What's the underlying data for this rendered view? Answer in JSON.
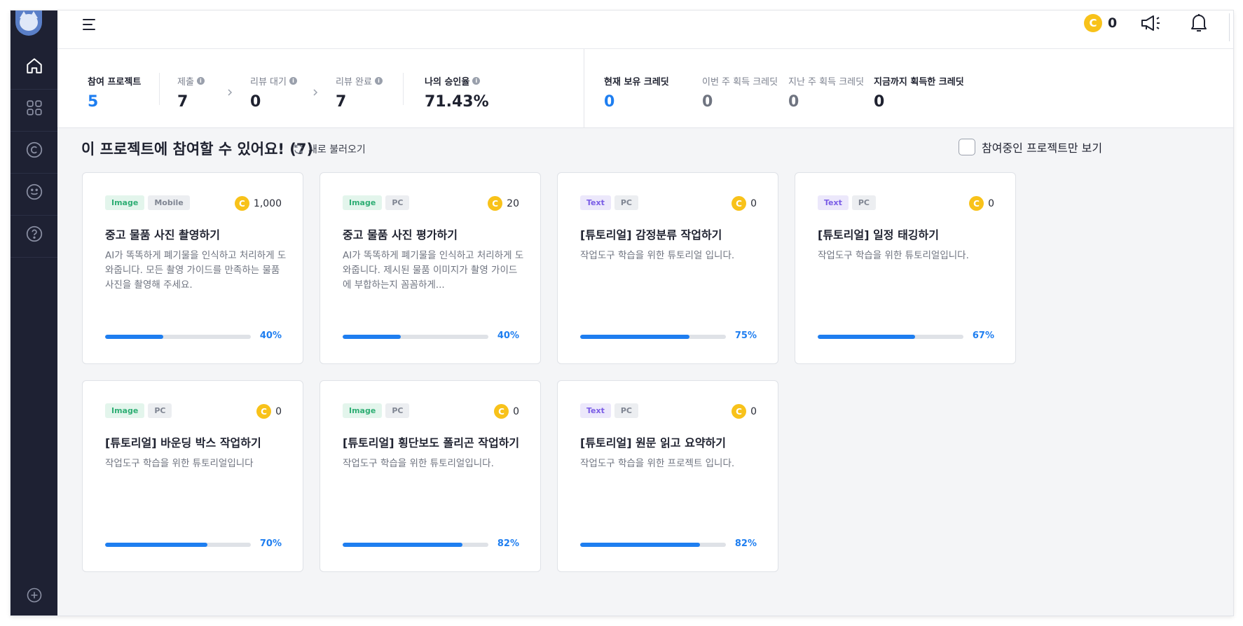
{
  "header": {
    "credit_value": "0",
    "coin_glyph": "C"
  },
  "sidebar": {
    "items": [
      {
        "name": "home",
        "icon": "home-icon"
      },
      {
        "name": "projects",
        "icon": "grid-icon"
      },
      {
        "name": "credit",
        "icon": "copyright-icon"
      },
      {
        "name": "profile",
        "icon": "smile-icon"
      },
      {
        "name": "help",
        "icon": "question-icon"
      }
    ],
    "add_icon": "plus-circle-icon"
  },
  "stats": {
    "participating_label": "참여 프로젝트",
    "participating_value": "5",
    "submitted_label": "제출",
    "submitted_value": "7",
    "review_pending_label": "리뷰 대기",
    "review_pending_value": "0",
    "review_done_label": "리뷰 완료",
    "review_done_value": "7",
    "approval_label": "나의 승인율",
    "approval_value": "71.43%",
    "credit_current_label": "현재 보유 크레딧",
    "credit_current_value": "0",
    "credit_this_week_label": "이번 주 획득 크레딧",
    "credit_this_week_value": "0",
    "credit_last_week_label": "지난 주 획득 크레딧",
    "credit_last_week_value": "0",
    "credit_total_label": "지금까지 획득한 크레딧",
    "credit_total_value": "0"
  },
  "section": {
    "title": "이 프로젝트에 참여할 수 있어요! (7)",
    "reload_label": "새로 불러오기",
    "filter_label": "참여중인 프로젝트만 보기"
  },
  "projects": [
    {
      "type": "Image",
      "platform": "Mobile",
      "reward": "1,000",
      "title": "중고 물품 사진 촬영하기",
      "desc": "AI가 똑똑하게 폐기물을 인식하고 처리하게 도와줍니다. 모든 촬영 가이드를 만족하는 물품 사진을 촬영해 주세요.",
      "progress_pct": 40,
      "progress_label": "40%"
    },
    {
      "type": "Image",
      "platform": "PC",
      "reward": "20",
      "title": "중고 물품 사진 평가하기",
      "desc": "AI가 똑똑하게 폐기물을 인식하고 처리하게 도와줍니다. 제시된 물품 이미지가 촬영 가이드에 부합하는지 꼼꼼하게...",
      "progress_pct": 40,
      "progress_label": "40%"
    },
    {
      "type": "Text",
      "platform": "PC",
      "reward": "0",
      "title": "[튜토리얼] 감정분류 작업하기",
      "desc": "작업도구 학습을 위한 튜토리얼 입니다.",
      "progress_pct": 75,
      "progress_label": "75%"
    },
    {
      "type": "Text",
      "platform": "PC",
      "reward": "0",
      "title": "[튜토리얼] 일정 태깅하기",
      "desc": "작업도구 학습을 위한 튜토리얼입니다.",
      "progress_pct": 67,
      "progress_label": "67%"
    },
    {
      "type": "Image",
      "platform": "PC",
      "reward": "0",
      "title": "[튜토리얼] 바운딩 박스 작업하기",
      "desc": "작업도구 학습을 위한 튜토리얼입니다",
      "progress_pct": 70,
      "progress_label": "70%"
    },
    {
      "type": "Image",
      "platform": "PC",
      "reward": "0",
      "title": "[튜토리얼] 횡단보도 폴리곤 작업하기",
      "desc": "작업도구 학습을 위한 튜토리얼입니다.",
      "progress_pct": 82,
      "progress_label": "82%"
    },
    {
      "type": "Text",
      "platform": "PC",
      "reward": "0",
      "title": "[튜토리얼] 원문 읽고 요약하기",
      "desc": "작업도구 학습을 위한 프로젝트 입니다.",
      "progress_pct": 82,
      "progress_label": "82%"
    }
  ],
  "colors": {
    "sidebar_bg": "#1e2133",
    "accent_blue": "#1e7ef0",
    "coin_yellow": "#f8c21a",
    "image_tag": "#2fae74",
    "text_tag": "#7a5ce6"
  }
}
